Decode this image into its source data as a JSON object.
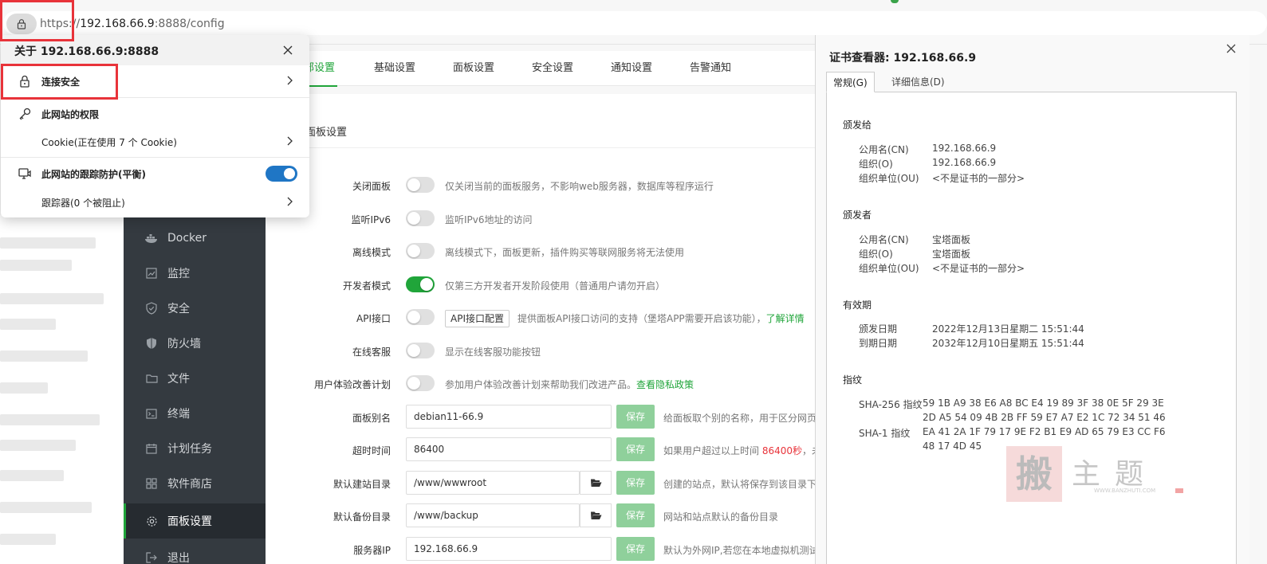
{
  "browser": {
    "url_scheme": "https://",
    "url_host": "192.168.66.9",
    "url_rest": ":8888/config"
  },
  "site_popup": {
    "title": "关于 192.168.66.9:8888",
    "connection": "连接安全",
    "permissions": "此网站的权限",
    "cookies": "Cookie(正在使用 7 个 Cookie)",
    "tracking": "此网站的跟踪防护(平衡)",
    "tracking_on": true,
    "trackers": "跟踪器(0 个被阻止)"
  },
  "sidebar": {
    "items": [
      {
        "label": "Docker",
        "icon": "docker-icon"
      },
      {
        "label": "监控",
        "icon": "monitor-icon"
      },
      {
        "label": "安全",
        "icon": "shield-check-icon"
      },
      {
        "label": "防火墙",
        "icon": "firewall-icon"
      },
      {
        "label": "文件",
        "icon": "folder-icon"
      },
      {
        "label": "终端",
        "icon": "terminal-icon"
      },
      {
        "label": "计划任务",
        "icon": "calendar-icon"
      },
      {
        "label": "软件商店",
        "icon": "grid-icon"
      },
      {
        "label": "面板设置",
        "icon": "gear-icon",
        "active": true
      },
      {
        "label": "退出",
        "icon": "logout-icon"
      }
    ]
  },
  "tabs": [
    {
      "label": "部设置",
      "active": true
    },
    {
      "label": "基础设置"
    },
    {
      "label": "面板设置"
    },
    {
      "label": "安全设置"
    },
    {
      "label": "通知设置"
    },
    {
      "label": "告警通知"
    }
  ],
  "panel": {
    "title": "面板设置",
    "toggles": [
      {
        "label": "关闭面板",
        "on": false,
        "desc": "仅关闭当前的面板服务，不影响web服务器，数据库等程序运行"
      },
      {
        "label": "监听IPv6",
        "on": false,
        "desc": "监听IPv6地址的访问"
      },
      {
        "label": "离线模式",
        "on": false,
        "desc": "离线模式下，面板更新，插件购买等联网服务将无法使用"
      },
      {
        "label": "开发者模式",
        "on": true,
        "desc": "仅第三方开发者开发阶段使用（普通用户请勿开启）"
      },
      {
        "label": "API接口",
        "on": false,
        "button": "API接口配置",
        "desc": "提供面板API接口访问的支持（堡塔APP需要开启该功能），",
        "link": "了解详情"
      },
      {
        "label": "在线客服",
        "on": false,
        "desc": "显示在线客服功能按钮"
      },
      {
        "label": "用户体验改善计划",
        "on": false,
        "desc": "参加用户体验改善计划来帮助我们改进产品。",
        "link": "查看隐私政策"
      }
    ],
    "fields": [
      {
        "label": "面板别名",
        "value": "debian11-66.9",
        "desc": "给面板取个别的名称，用于区分网页标题"
      },
      {
        "label": "超时时间",
        "value": "86400",
        "desc_pre": "如果用户超过以上时间 ",
        "desc_red": "86400秒",
        "desc_post": "，未"
      },
      {
        "label": "默认建站目录",
        "value": "/www/wwwroot",
        "folder": true,
        "desc": "创建的站点，默认将保存到该目录下"
      },
      {
        "label": "默认备份目录",
        "value": "/www/backup",
        "folder": true,
        "desc": "网站和站点默认的备份目录"
      },
      {
        "label": "服务器IP",
        "value": "192.168.66.9",
        "desc": "默认为外网IP,若您在本地虚拟机测试"
      }
    ],
    "save_label": "保存"
  },
  "cert": {
    "title": "证书查看器: 192.168.66.9",
    "tab_general": "常规(G)",
    "tab_details": "详细信息(D)",
    "issued_to": {
      "heading": "颁发给",
      "rows": [
        {
          "k": "公用名(CN)",
          "v": "192.168.66.9"
        },
        {
          "k": "组织(O)",
          "v": "192.168.66.9"
        },
        {
          "k": "组织单位(OU)",
          "v": "<不是证书的一部分>"
        }
      ]
    },
    "issued_by": {
      "heading": "颁发者",
      "rows": [
        {
          "k": "公用名(CN)",
          "v": "宝塔面板"
        },
        {
          "k": "组织(O)",
          "v": "宝塔面板"
        },
        {
          "k": "组织单位(OU)",
          "v": "<不是证书的一部分>"
        }
      ]
    },
    "validity": {
      "heading": "有效期",
      "rows": [
        {
          "k": "颁发日期",
          "v": "2022年12月13日星期二 15:51:44"
        },
        {
          "k": "到期日期",
          "v": "2032年12月10日星期五 15:51:44"
        }
      ]
    },
    "fingerprints": {
      "heading": "指纹",
      "sha256_label": "SHA-256 指纹",
      "sha256_line1": "59 1B A9 38 E6 A8 BC E4 19 89 3F 38 0E 5F 29 3E",
      "sha256_line2": "2D A5 54 09 4B 2B FF 59 E7 A7 E2 1C 72 34 51 46",
      "sha1_label": "SHA-1 指纹",
      "sha1_line1": "EA 41 2A 1F 79 17 9E F2 B1 E9 AD 65 79 E3 CC F6",
      "sha1_line2": "48 17 4D 45"
    }
  },
  "watermark": {
    "seal": "搬",
    "text": "主题",
    "url": "WWW.BANZHUTI.COM"
  }
}
